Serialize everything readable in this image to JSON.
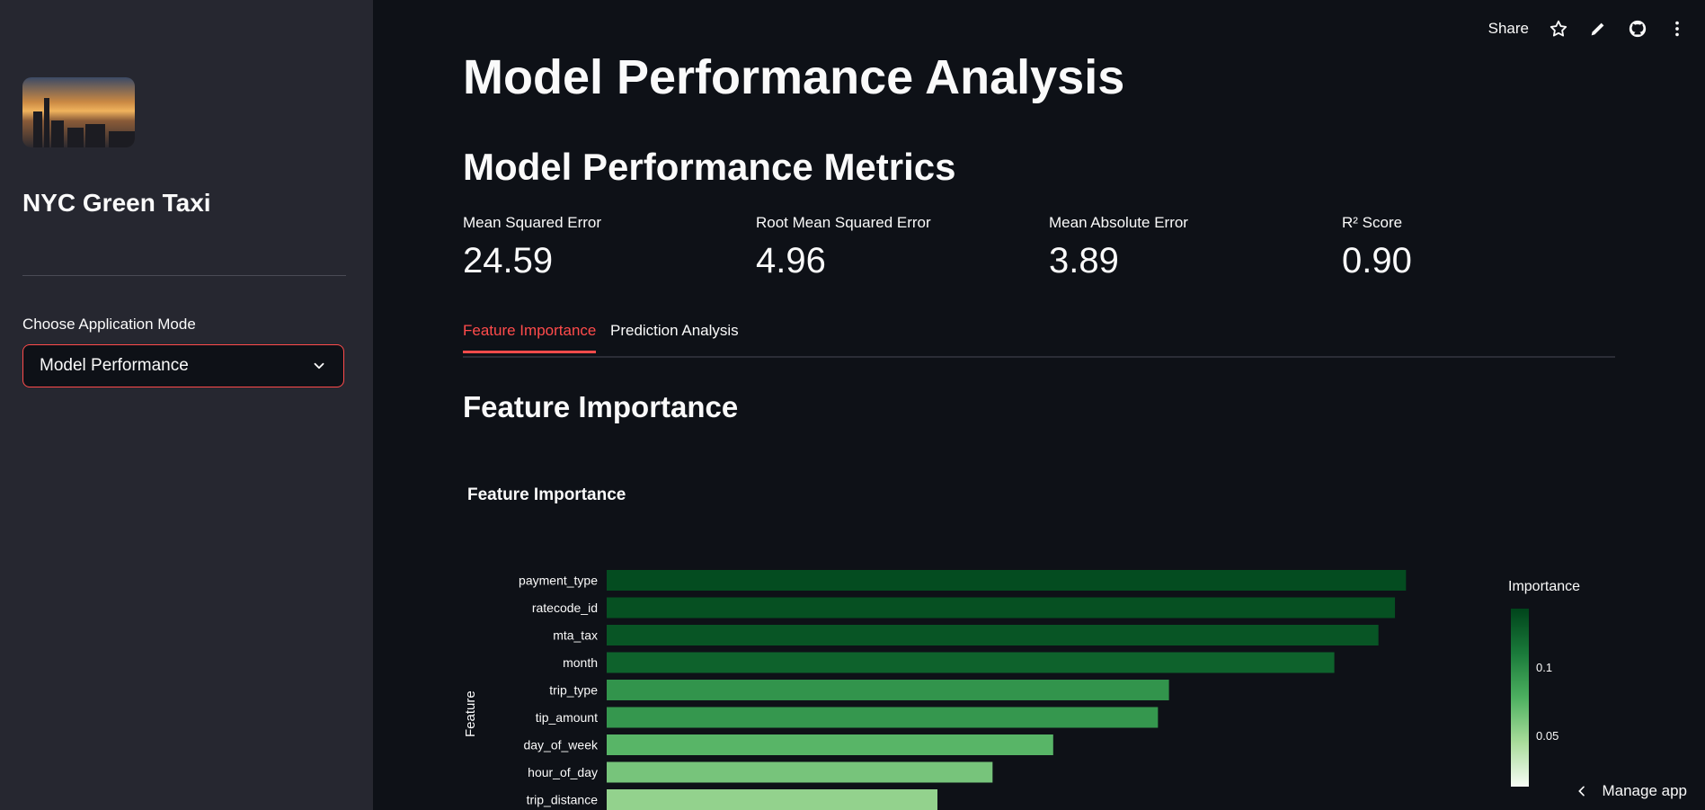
{
  "sidebar": {
    "app_title": "NYC Green Taxi",
    "mode_label": "Choose Application Mode",
    "mode_value": "Model Performance"
  },
  "toolbar": {
    "share": "Share",
    "icons": [
      "star-icon",
      "pencil-icon",
      "github-icon",
      "more-vertical-icon"
    ]
  },
  "main": {
    "title": "Model Performance Analysis",
    "metrics_title": "Model Performance Metrics",
    "metrics": [
      {
        "label": "Mean Squared Error",
        "value": "24.59"
      },
      {
        "label": "Root Mean Squared Error",
        "value": "4.96"
      },
      {
        "label": "Mean Absolute Error",
        "value": "3.89"
      },
      {
        "label": "R² Score",
        "value": "0.90"
      }
    ],
    "tabs": [
      {
        "label": "Feature Importance",
        "active": true
      },
      {
        "label": "Prediction Analysis",
        "active": false
      }
    ],
    "section_title": "Feature Importance"
  },
  "chart_data": {
    "type": "bar",
    "orientation": "horizontal",
    "title": "Feature Importance",
    "ylabel": "Feature",
    "xlabel": "",
    "categories": [
      "payment_type",
      "ratecode_id",
      "mta_tax",
      "month",
      "trip_type",
      "tip_amount",
      "day_of_week",
      "hour_of_day",
      "trip_distance"
    ],
    "values": [
      0.145,
      0.143,
      0.14,
      0.132,
      0.102,
      0.1,
      0.081,
      0.07,
      0.06
    ],
    "colorbar": {
      "title": "Importance",
      "ticks": [
        "0.1",
        "0.05"
      ],
      "colorscale": "Greens"
    },
    "colors": {
      "low": "#f7fcf5",
      "high": "#00441b"
    }
  },
  "footer": {
    "manage_app": "Manage app"
  }
}
